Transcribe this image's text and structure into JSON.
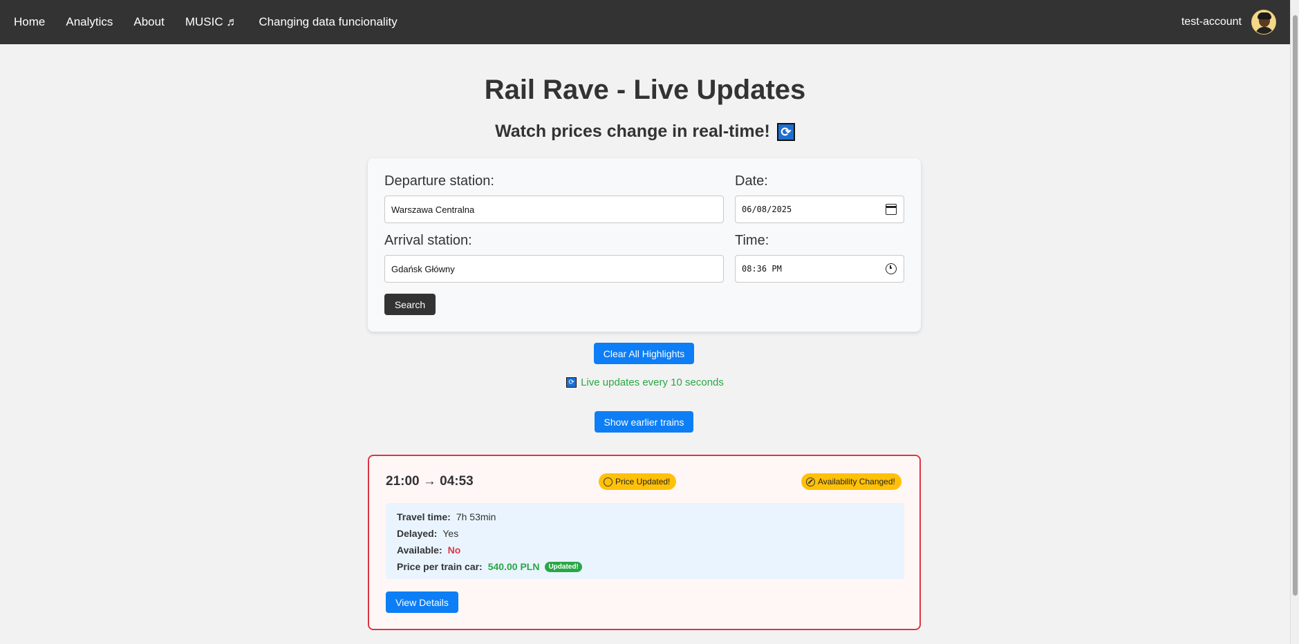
{
  "nav": {
    "links": [
      "Home",
      "Analytics",
      "About",
      "MUSIC ♬",
      "Changing data funcionality"
    ],
    "username": "test-account"
  },
  "header": {
    "title": "Rail Rave - Live Updates",
    "subtitle": "Watch prices change in real-time!"
  },
  "search_form": {
    "departure_label": "Departure station:",
    "departure_value": "Warszawa Centralna",
    "date_label": "Date:",
    "date_value": "06/08/2025",
    "arrival_label": "Arrival station:",
    "arrival_value": "Gdańsk Główny",
    "time_label": "Time:",
    "time_value": "08:36 PM",
    "search_label": "Search"
  },
  "controls": {
    "clear_highlights_label": "Clear All Highlights",
    "live_updates_text": "Live updates every 10 seconds",
    "earlier_trains_label": "Show earlier trains"
  },
  "train": {
    "route": "21:00 → 04:53",
    "price_badge": "Price Updated!",
    "availability_badge": "Availability Changed!",
    "travel_time_label": "Travel time:",
    "travel_time_value": "7h 53min",
    "delayed_label": "Delayed:",
    "delayed_value": "Yes",
    "available_label": "Available:",
    "available_value": "No",
    "price_label": "Price per train car:",
    "price_value": "540.00 PLN",
    "price_updated_pill": "Updated!",
    "view_details_label": "View Details"
  },
  "colors": {
    "navbar": "#333333",
    "accent_blue": "#0d7ef5",
    "highlight_red": "#dc3545",
    "badge_yellow": "#ffc107",
    "success_green": "#28a745"
  },
  "icons": [
    "refresh-icon",
    "calendar-icon",
    "clock-icon",
    "moneybag-icon",
    "no-entry-icon",
    "avatar"
  ]
}
